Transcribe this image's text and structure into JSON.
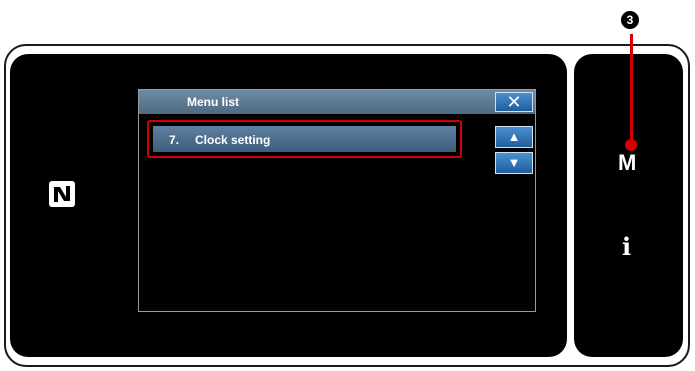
{
  "window": {
    "title": "Menu list",
    "close_glyph": "✕"
  },
  "list": {
    "items": [
      {
        "number": "7.",
        "label": "Clock setting",
        "selected": true
      }
    ]
  },
  "scroll": {
    "up_glyph": "▲",
    "down_glyph": "▼"
  },
  "side_keys": {
    "menu_key": "M",
    "info_key": "i"
  },
  "callout": {
    "number": "3"
  },
  "colors": {
    "highlight": "#d40000",
    "button_blue": "#1f5e9c",
    "titlebar": "#5a7690"
  },
  "icons": {
    "nfc": "nfc-icon",
    "close": "close-icon",
    "up": "up-arrow-icon",
    "down": "down-arrow-icon"
  }
}
